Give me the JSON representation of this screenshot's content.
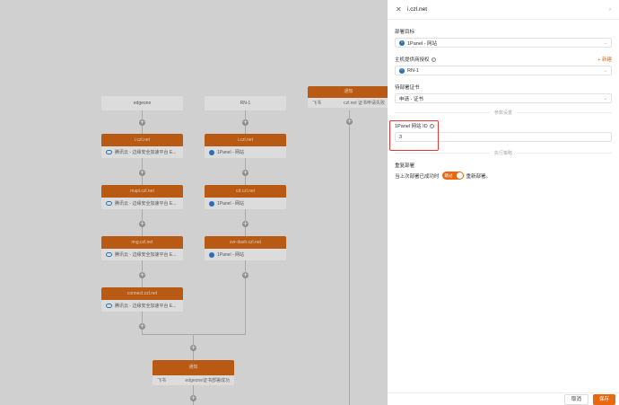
{
  "canvas": {
    "domain_cards": [
      {
        "label": "edgeone"
      },
      {
        "label": "RN-1"
      }
    ],
    "nodes_left": [
      {
        "head": "i.czl.net",
        "body": "腾讯云 - 边缘安全加速平台 E..."
      },
      {
        "head": "mapi.czl.net",
        "body": "腾讯云 - 边缘安全加速平台 E..."
      },
      {
        "head": "img.czl.net",
        "body": "腾讯云 - 边缘安全加速平台 E..."
      },
      {
        "head": "connect.czl.net",
        "body": "腾讯云 - 边缘安全加速平台 E..."
      }
    ],
    "nodes_mid": [
      {
        "head": "i.czl.net",
        "body": "1Panel - 网站"
      },
      {
        "head": "cd.czl.net",
        "body": "1Panel - 网站"
      },
      {
        "head": "svr-dash.czl.net",
        "body": "1Panel - 网站"
      }
    ],
    "notify_top": {
      "head": "通知",
      "left": "飞书",
      "right": "czl.net 证书申请失败"
    },
    "notify_bottom": {
      "head": "通知",
      "left": "飞书",
      "right": "edgeone证书部署成功"
    }
  },
  "drawer": {
    "title": "i.czl.net",
    "deploy_target_label": "部署目标",
    "deploy_target_value": "1Panel - 网站",
    "provider_label": "主机提供商授权",
    "provider_add": "+ 新建",
    "provider_value": "RN-1",
    "cert_label": "待部署证书",
    "cert_value": "申请 - 证书",
    "params_divider": "参数设置",
    "site_id_label": "1Panel 网站 ID",
    "site_id_value": "3",
    "strategy_divider": "执行策略",
    "redeploy_label": "重复部署",
    "redeploy_prefix": "当上次部署已成功时",
    "toggle_text": "跳过",
    "redeploy_suffix": "重新部署。",
    "cancel": "取消",
    "save": "保存"
  },
  "colors": {
    "accent": "#e8680f",
    "highlight": "#e53935",
    "node_head": "#b85a14"
  }
}
